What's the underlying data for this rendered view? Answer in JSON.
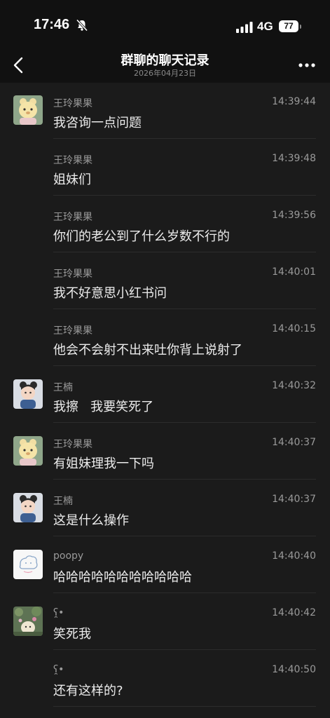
{
  "status_bar": {
    "time": "17:46",
    "network": "4G",
    "battery": "77"
  },
  "header": {
    "title": "群聊的聊天记录",
    "subtitle": "2026年04月23日"
  },
  "messages": [
    {
      "sender": "王玲果果",
      "time": "14:39:44",
      "text": "我咨询一点问题",
      "avatar": "bear"
    },
    {
      "sender": "王玲果果",
      "time": "14:39:48",
      "text": "姐妹们",
      "avatar": "none"
    },
    {
      "sender": "王玲果果",
      "time": "14:39:56",
      "text": "你们的老公到了什么岁数不行的",
      "avatar": "none"
    },
    {
      "sender": "王玲果果",
      "time": "14:40:01",
      "text": "我不好意思小红书问",
      "avatar": "none"
    },
    {
      "sender": "王玲果果",
      "time": "14:40:15",
      "text": "他会不会射不出来吐你背上说射了",
      "avatar": "none"
    },
    {
      "sender": "王楠",
      "time": "14:40:32",
      "text": "我擦   我要笑死了",
      "avatar": "baby"
    },
    {
      "sender": "王玲果果",
      "time": "14:40:37",
      "text": "有姐妹理我一下吗",
      "avatar": "bear"
    },
    {
      "sender": "王楠",
      "time": "14:40:37",
      "text": "这是什么操作",
      "avatar": "baby"
    },
    {
      "sender": "poopy",
      "time": "14:40:40",
      "text": "哈哈哈哈哈哈哈哈哈哈哈",
      "avatar": "doodle"
    },
    {
      "sender": "ʕ̯•",
      "time": "14:40:42",
      "text": "笑死我",
      "avatar": "garden"
    },
    {
      "sender": "ʕ̯•",
      "time": "14:40:50",
      "text": "还有这样的?",
      "avatar": "none"
    }
  ],
  "colors": {
    "background": "#1b1b1b",
    "bar": "#111111",
    "meta": "#9a9a9a",
    "text": "#ececec"
  },
  "icons": [
    "mute-icon",
    "signal-icon",
    "back-icon",
    "more-icon"
  ]
}
